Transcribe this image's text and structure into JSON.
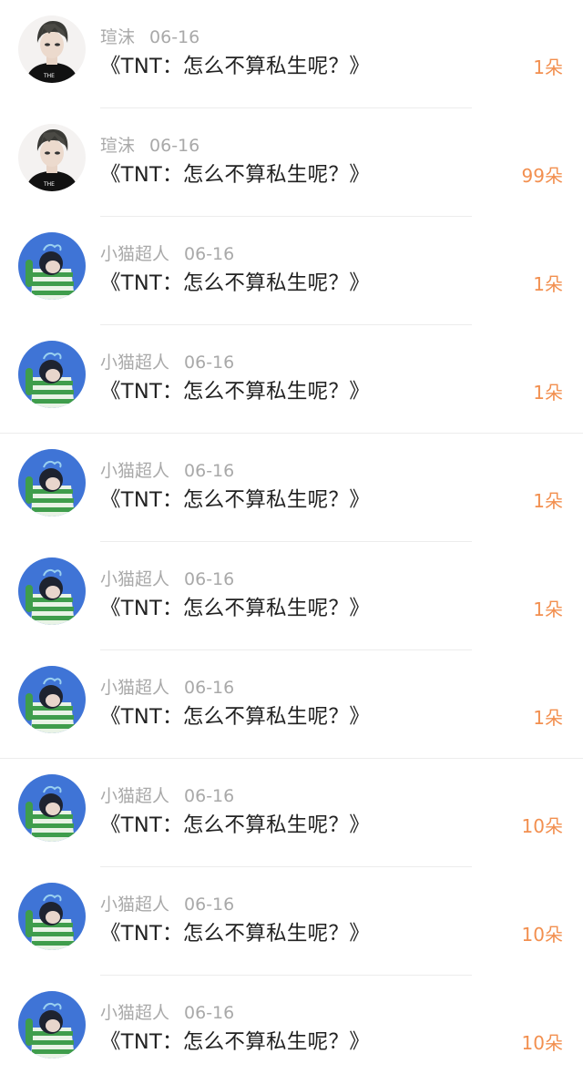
{
  "rows": [
    {
      "user": "瑄沫",
      "date": "06-16",
      "title": "《TNT：怎么不算私生呢？》",
      "count": "1朵",
      "avatar_icon": "dark-hair-boy-avatar"
    },
    {
      "user": "瑄沫",
      "date": "06-16",
      "title": "《TNT：怎么不算私生呢？》",
      "count": "99朵",
      "avatar_icon": "dark-hair-boy-avatar"
    },
    {
      "user": "小猫超人",
      "date": "06-16",
      "title": "《TNT：怎么不算私生呢？》",
      "count": "1朵",
      "avatar_icon": "green-stripe-boy-avatar"
    },
    {
      "user": "小猫超人",
      "date": "06-16",
      "title": "《TNT：怎么不算私生呢？》",
      "count": "1朵",
      "avatar_icon": "green-stripe-boy-avatar"
    },
    {
      "user": "小猫超人",
      "date": "06-16",
      "title": "《TNT：怎么不算私生呢？》",
      "count": "1朵",
      "avatar_icon": "green-stripe-boy-avatar"
    },
    {
      "user": "小猫超人",
      "date": "06-16",
      "title": "《TNT：怎么不算私生呢？》",
      "count": "1朵",
      "avatar_icon": "green-stripe-boy-avatar"
    },
    {
      "user": "小猫超人",
      "date": "06-16",
      "title": "《TNT：怎么不算私生呢？》",
      "count": "1朵",
      "avatar_icon": "green-stripe-boy-avatar"
    },
    {
      "user": "小猫超人",
      "date": "06-16",
      "title": "《TNT：怎么不算私生呢？》",
      "count": "10朵",
      "avatar_icon": "green-stripe-boy-avatar"
    },
    {
      "user": "小猫超人",
      "date": "06-16",
      "title": "《TNT：怎么不算私生呢？》",
      "count": "10朵",
      "avatar_icon": "green-stripe-boy-avatar"
    },
    {
      "user": "小猫超人",
      "date": "06-16",
      "title": "《TNT：怎么不算私生呢？》",
      "count": "10朵",
      "avatar_icon": "green-stripe-boy-avatar"
    }
  ],
  "colors": {
    "count_accent": "#f28f4f",
    "meta_gray": "#a9a9a9",
    "title_text": "#222222"
  }
}
